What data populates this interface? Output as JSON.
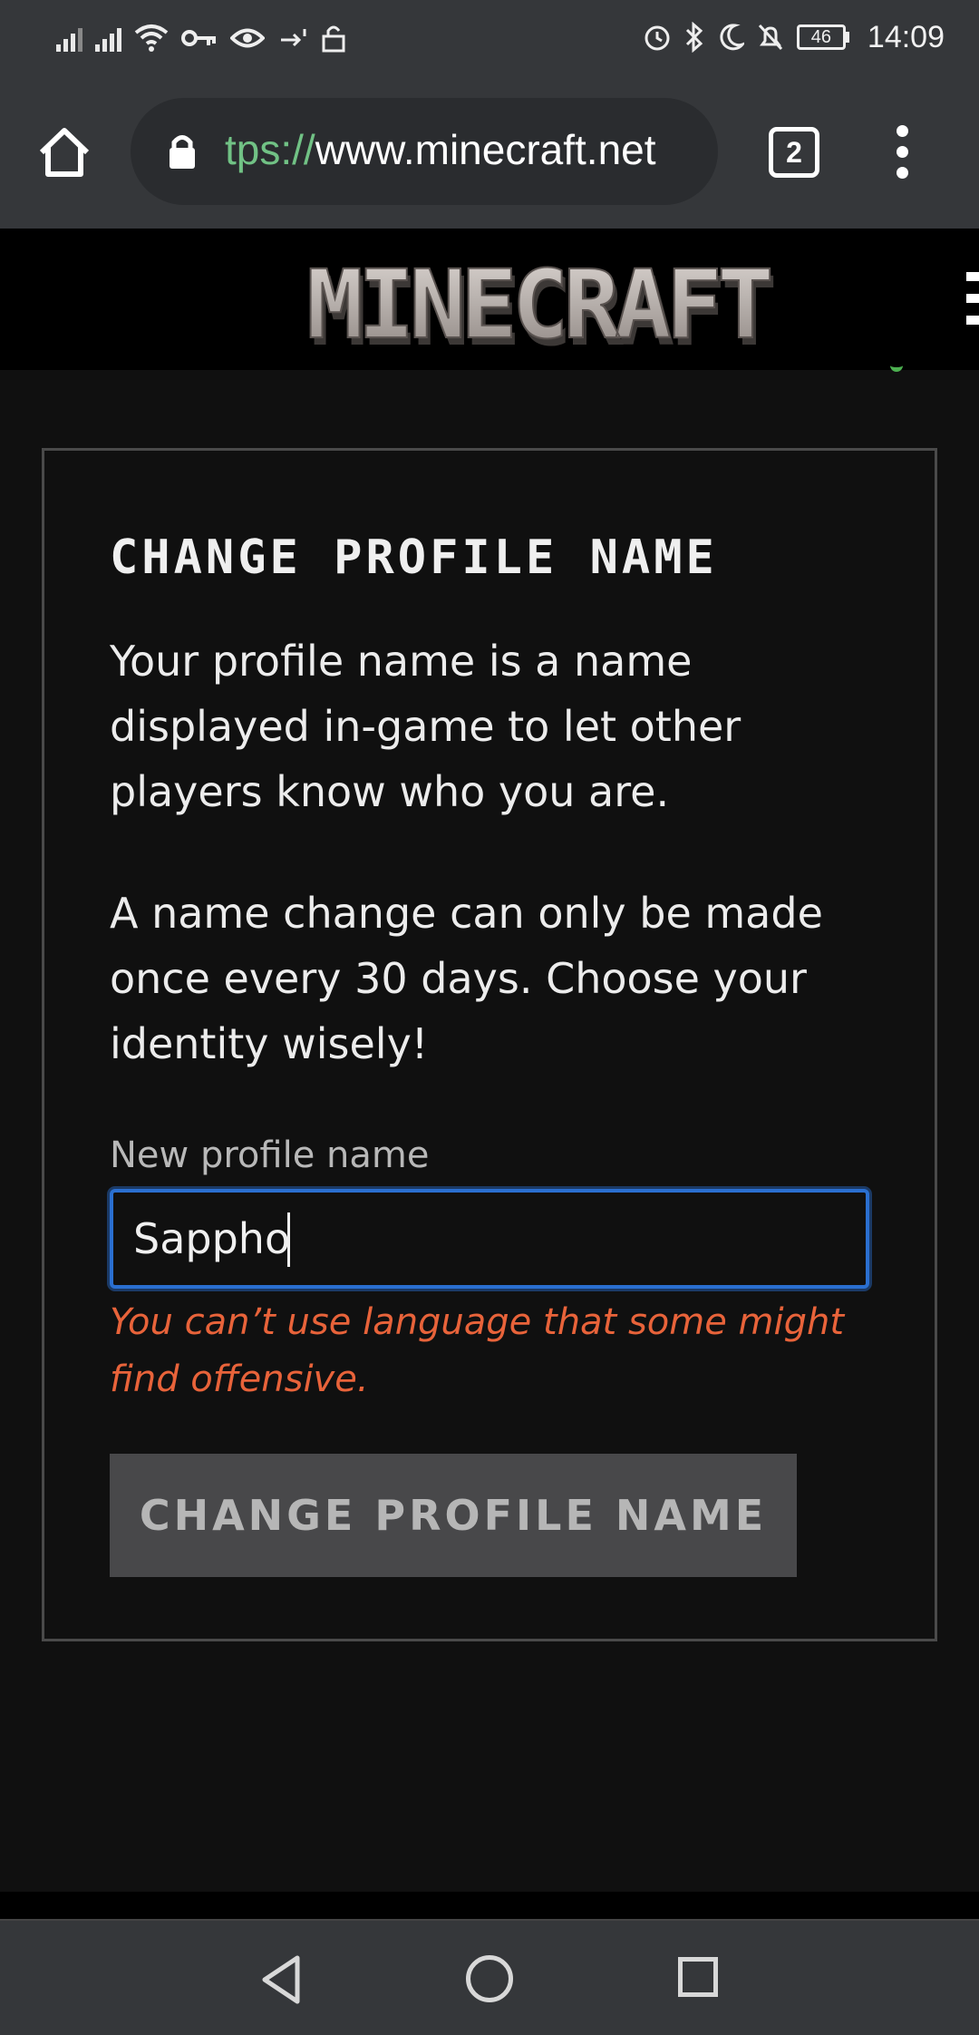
{
  "status_bar": {
    "battery": "46",
    "time": "14:09"
  },
  "browser": {
    "url_scheme": "tps://",
    "url_host": "www.minecraft.net",
    "tab_count": "2"
  },
  "site": {
    "logo_text": "MINECRAFT"
  },
  "form": {
    "title": "CHANGE PROFILE NAME",
    "paragraph_1": "Your profile name is a name displayed in-game to let other players know who you are.",
    "paragraph_2": "A name change can only be made once every 30 days. Choose your identity wisely!",
    "field_label": "New profile name",
    "field_value": "Sappho",
    "error": "You can’t use language that some might find offensive.",
    "submit_label": "CHANGE PROFILE NAME"
  },
  "colors": {
    "url_scheme": "#71c285",
    "input_focus": "#2a6fd0",
    "error": "#e8633a",
    "button_bg": "#48484a"
  }
}
